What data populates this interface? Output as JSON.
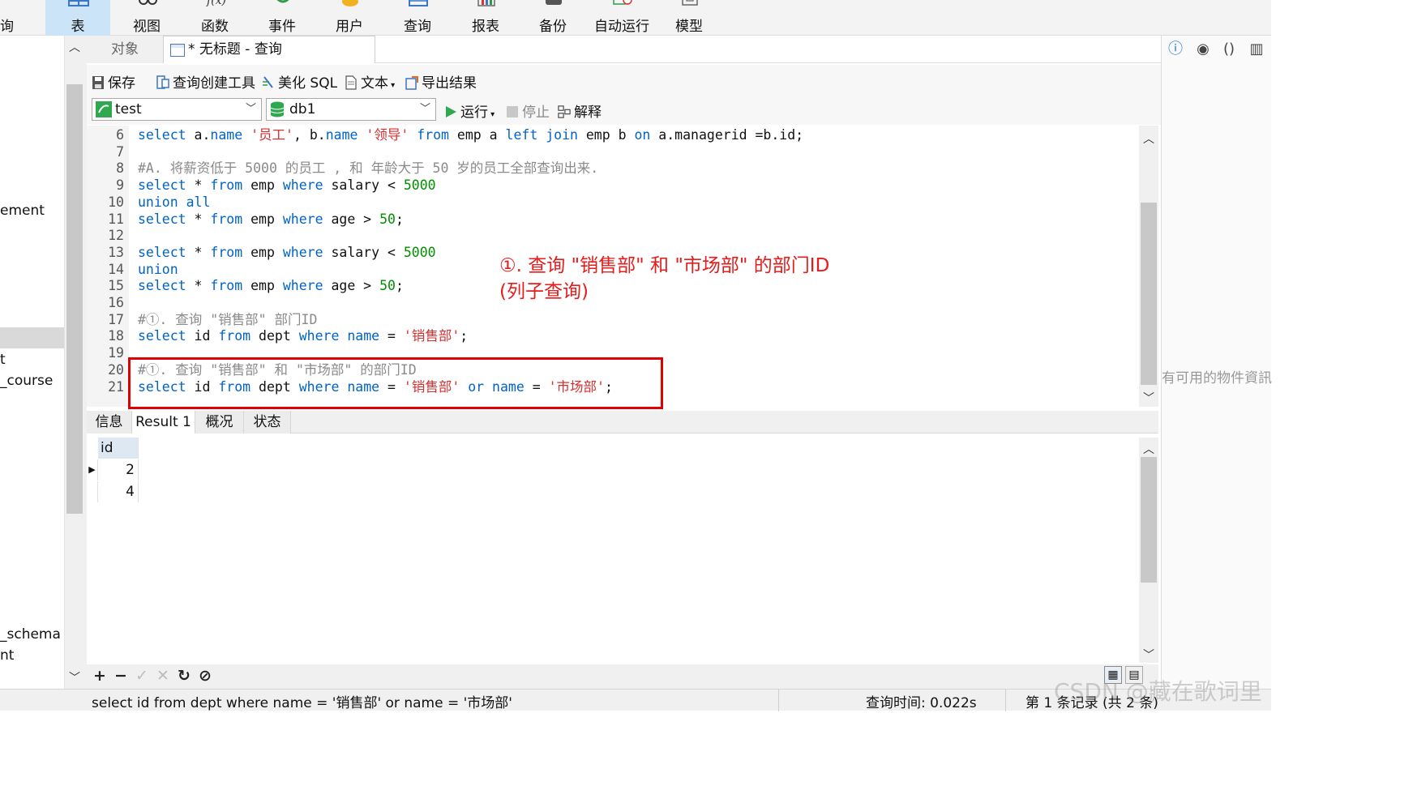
{
  "ribbon": {
    "cut_left": "询",
    "items": [
      {
        "label": "表",
        "icon": "table-icon",
        "active": true
      },
      {
        "label": "视图",
        "icon": "view-icon"
      },
      {
        "label": "函数",
        "icon": "function-icon"
      },
      {
        "label": "事件",
        "icon": "event-icon"
      },
      {
        "label": "用户",
        "icon": "user-icon"
      },
      {
        "label": "查询",
        "icon": "query-icon"
      },
      {
        "label": "报表",
        "icon": "report-icon"
      },
      {
        "label": "备份",
        "icon": "backup-icon"
      },
      {
        "label": "自动运行",
        "icon": "automation-icon"
      },
      {
        "label": "模型",
        "icon": "model-icon"
      }
    ]
  },
  "leftnav": {
    "items": [
      "ement",
      "t",
      "_course",
      "_schema",
      "nt"
    ]
  },
  "tabs": {
    "objects": "对象",
    "query": "* 无标题 - 查询"
  },
  "toolbar": {
    "save": "保存",
    "query_builder": "查询创建工具",
    "beautify": "美化 SQL",
    "text": "文本",
    "export": "导出结果"
  },
  "connection": {
    "conn": "test",
    "db": "db1",
    "run": "运行",
    "stop": "停止",
    "explain": "解释"
  },
  "editor": {
    "lines": [
      {
        "n": "6",
        "tokens": [
          [
            "kw",
            "select"
          ],
          [
            "p",
            " a."
          ],
          [
            "kw",
            "name"
          ],
          [
            "p",
            " "
          ],
          [
            "str",
            "'员工'"
          ],
          [
            "p",
            ", b."
          ],
          [
            "kw",
            "name"
          ],
          [
            "p",
            " "
          ],
          [
            "str",
            "'领导'"
          ],
          [
            "p",
            " "
          ],
          [
            "kw",
            "from"
          ],
          [
            "p",
            " emp a "
          ],
          [
            "kw",
            "left join"
          ],
          [
            "p",
            " emp b "
          ],
          [
            "kw",
            "on"
          ],
          [
            "p",
            " a.managerid =b.id;"
          ]
        ]
      },
      {
        "n": "7",
        "tokens": []
      },
      {
        "n": "8",
        "tokens": [
          [
            "cmt",
            "#A. 将薪资低于 5000 的员工 , 和 年龄大于 50 岁的员工全部查询出来."
          ]
        ]
      },
      {
        "n": "9",
        "tokens": [
          [
            "kw",
            "select"
          ],
          [
            "p",
            " * "
          ],
          [
            "kw",
            "from"
          ],
          [
            "p",
            " emp "
          ],
          [
            "kw",
            "where"
          ],
          [
            "p",
            " salary < "
          ],
          [
            "num",
            "5000"
          ]
        ]
      },
      {
        "n": "10",
        "tokens": [
          [
            "kw",
            "union all"
          ]
        ]
      },
      {
        "n": "11",
        "tokens": [
          [
            "kw",
            "select"
          ],
          [
            "p",
            " * "
          ],
          [
            "kw",
            "from"
          ],
          [
            "p",
            " emp "
          ],
          [
            "kw",
            "where"
          ],
          [
            "p",
            " age > "
          ],
          [
            "num",
            "50"
          ],
          [
            "p",
            ";"
          ]
        ]
      },
      {
        "n": "12",
        "tokens": []
      },
      {
        "n": "13",
        "tokens": [
          [
            "kw",
            "select"
          ],
          [
            "p",
            " * "
          ],
          [
            "kw",
            "from"
          ],
          [
            "p",
            " emp "
          ],
          [
            "kw",
            "where"
          ],
          [
            "p",
            " salary < "
          ],
          [
            "num",
            "5000"
          ]
        ]
      },
      {
        "n": "14",
        "tokens": [
          [
            "kw",
            "union"
          ]
        ]
      },
      {
        "n": "15",
        "tokens": [
          [
            "kw",
            "select"
          ],
          [
            "p",
            " * "
          ],
          [
            "kw",
            "from"
          ],
          [
            "p",
            " emp "
          ],
          [
            "kw",
            "where"
          ],
          [
            "p",
            " age > "
          ],
          [
            "num",
            "50"
          ],
          [
            "p",
            ";"
          ]
        ]
      },
      {
        "n": "16",
        "tokens": []
      },
      {
        "n": "17",
        "tokens": [
          [
            "cmt",
            "#①. 查询 \"销售部\" 部门ID"
          ]
        ]
      },
      {
        "n": "18",
        "tokens": [
          [
            "kw",
            "select"
          ],
          [
            "p",
            " id "
          ],
          [
            "kw",
            "from"
          ],
          [
            "p",
            " dept "
          ],
          [
            "kw",
            "where"
          ],
          [
            "p",
            " "
          ],
          [
            "kw",
            "name"
          ],
          [
            "p",
            " = "
          ],
          [
            "str",
            "'销售部'"
          ],
          [
            "p",
            ";"
          ]
        ]
      },
      {
        "n": "19",
        "tokens": []
      },
      {
        "n": "20",
        "tokens": [
          [
            "cmt",
            "#①. 查询 \"销售部\" 和 \"市场部\" 的部门ID"
          ]
        ]
      },
      {
        "n": "21",
        "tokens": [
          [
            "kw",
            "select"
          ],
          [
            "p",
            " id "
          ],
          [
            "kw",
            "from"
          ],
          [
            "p",
            " dept "
          ],
          [
            "kw",
            "where"
          ],
          [
            "p",
            " "
          ],
          [
            "kw",
            "name"
          ],
          [
            "p",
            " = "
          ],
          [
            "str",
            "'销售部'"
          ],
          [
            "p",
            " "
          ],
          [
            "kw",
            "or"
          ],
          [
            "p",
            " "
          ],
          [
            "kw",
            "name"
          ],
          [
            "p",
            " = "
          ],
          [
            "str",
            "'市场部'"
          ],
          [
            "p",
            ";"
          ]
        ]
      }
    ]
  },
  "annotation": {
    "line1": "①. 查询 \"销售部\" 和 \"市场部\" 的部门ID",
    "line2": "(列子查询)",
    "color": "#e41c1c"
  },
  "result_tabs": [
    "信息",
    "Result 1",
    "概况",
    "状态"
  ],
  "active_result_tab": "Result 1",
  "grid": {
    "columns": [
      "id"
    ],
    "rows": [
      [
        "2"
      ],
      [
        "4"
      ]
    ]
  },
  "status": {
    "sql": "select id from dept where name = '销售部' or name = '市场部'",
    "time": "查询时间: 0.022s",
    "records": "第 1 条记录 (共 2 条)"
  },
  "right_panel": {
    "text": "有可用的物件資訊"
  },
  "watermark": "CSDN @藏在歌词里"
}
